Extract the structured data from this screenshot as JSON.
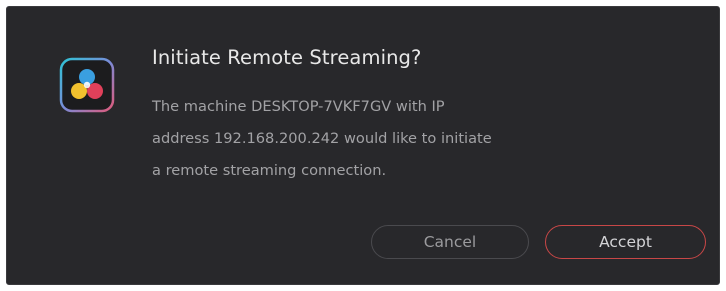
{
  "dialog": {
    "icon": "davinci-resolve-logo-icon",
    "title": "Initiate Remote Streaming?",
    "message_lines": [
      "The machine DESKTOP-7VKF7GV with IP",
      "address 192.168.200.242 would like to initiate",
      "a remote streaming connection."
    ],
    "buttons": {
      "cancel": "Cancel",
      "accept": "Accept"
    },
    "colors": {
      "background": "#28282b",
      "accept_border": "#c84747"
    }
  }
}
